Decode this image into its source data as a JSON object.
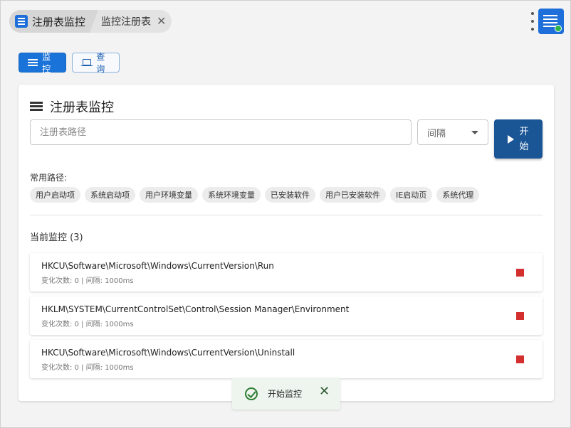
{
  "breadcrumb": {
    "app_title": "注册表监控",
    "current": "监控注册表",
    "close_glyph": "✕"
  },
  "tabs": [
    {
      "label": "监控",
      "icon": "list-icon",
      "active": true
    },
    {
      "label": "查询",
      "icon": "laptop-icon",
      "active": false
    }
  ],
  "panel": {
    "title": "注册表监控",
    "path_placeholder": "注册表路径",
    "interval_label": "间隔",
    "start_label": "开始",
    "quick_label": "常用路径:",
    "quick_paths": [
      "用户启动项",
      "系统启动项",
      "用户环境变量",
      "系统环境变量",
      "已安装软件",
      "用户已安装软件",
      "IE启动页",
      "系统代理"
    ],
    "section_title": "当前监控 (3)"
  },
  "monitors": [
    {
      "path": "HKCU\\Software\\Microsoft\\Windows\\CurrentVersion\\Run",
      "meta": "变化次数: 0 | 间隔: 1000ms"
    },
    {
      "path": "HKLM\\SYSTEM\\CurrentControlSet\\Control\\Session Manager\\Environment",
      "meta": "变化次数: 0 | 间隔: 1000ms"
    },
    {
      "path": "HKCU\\Software\\Microsoft\\Windows\\CurrentVersion\\Uninstall",
      "meta": "变化次数: 0 | 间隔: 1000ms"
    }
  ],
  "toast": {
    "text": "开始监控",
    "close_glyph": "✕"
  },
  "colors": {
    "primary": "#1a73d8",
    "start": "#1a5595",
    "stop": "#d32f2f",
    "success": "#2e7d32"
  }
}
